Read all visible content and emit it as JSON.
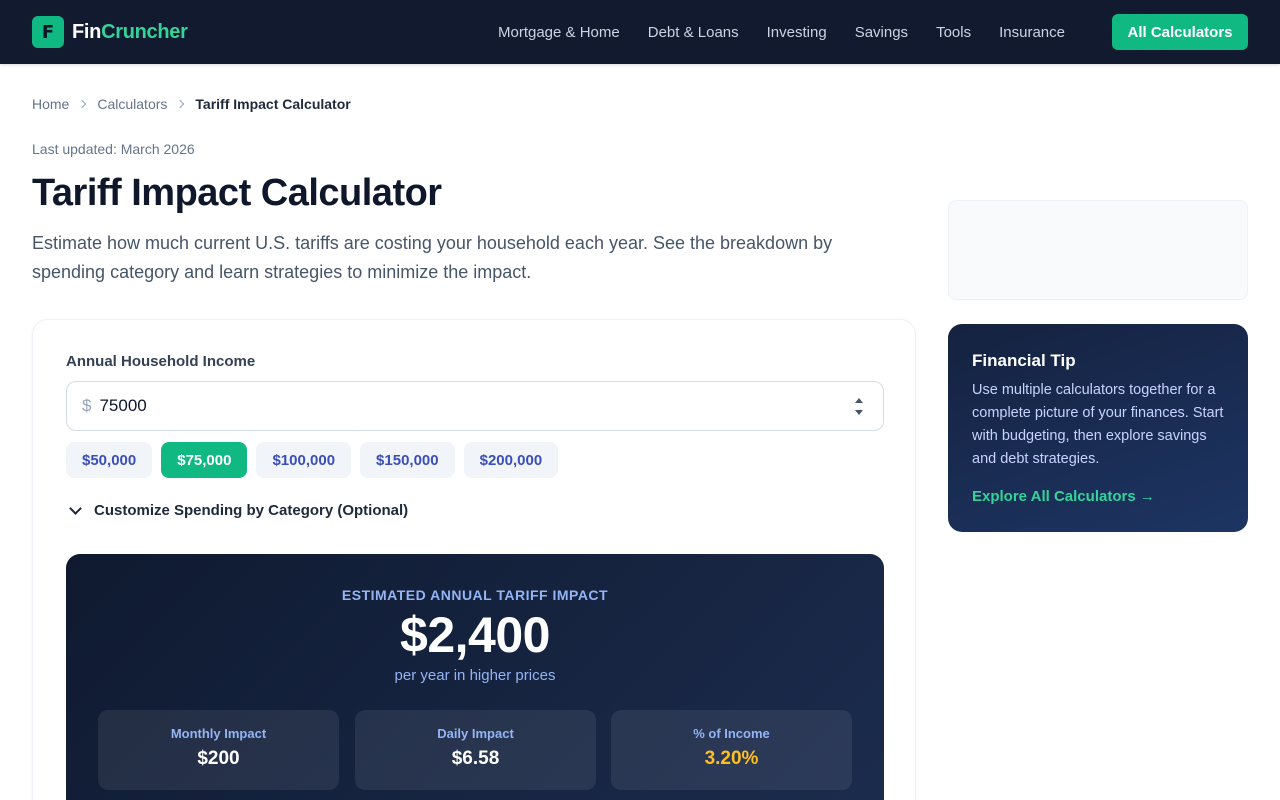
{
  "header": {
    "logo_letter": "F",
    "logo_part1": "Fin",
    "logo_part2": "Cruncher",
    "nav": [
      "Mortgage & Home",
      "Debt & Loans",
      "Investing",
      "Savings",
      "Tools",
      "Insurance"
    ],
    "cta_label": "All Calculators"
  },
  "breadcrumb": [
    "Home",
    "Calculators",
    "Tariff Impact Calculator"
  ],
  "updated": "Last updated: March 2026",
  "title": "Tariff Impact Calculator",
  "intro": "Estimate how much current U.S. tariffs are costing your household each year. See the breakdown by spending category and learn strategies to minimize the impact.",
  "calculator": {
    "income_label": "Annual Household Income",
    "currency_symbol": "$",
    "income_value": "75000",
    "presets": [
      "$50,000",
      "$75,000",
      "$100,000",
      "$150,000",
      "$200,000"
    ],
    "active_preset": "$75,000",
    "customize_label": "Customize Spending by Category (Optional)"
  },
  "result": {
    "eyebrow": "ESTIMATED ANNUAL TARIFF IMPACT",
    "amount": "$2,400",
    "subtitle": "per year in higher prices",
    "stats": [
      {
        "label": "Monthly Impact",
        "value": "$200"
      },
      {
        "label": "Daily Impact",
        "value": "$6.58"
      },
      {
        "label": "% of Income",
        "value": "3.20%"
      }
    ]
  },
  "sidebar": {
    "tip_title": "Financial Tip",
    "tip_body": "Use multiple calculators together for a complete picture of your finances. Start with budgeting, then explore savings and debt strategies.",
    "tip_link": "Explore All Calculators →"
  },
  "colors": {
    "brand": "#10b981",
    "header_bg": "#111a2e",
    "result_bg": "#0f1a30",
    "warn": "#fbbf24"
  }
}
